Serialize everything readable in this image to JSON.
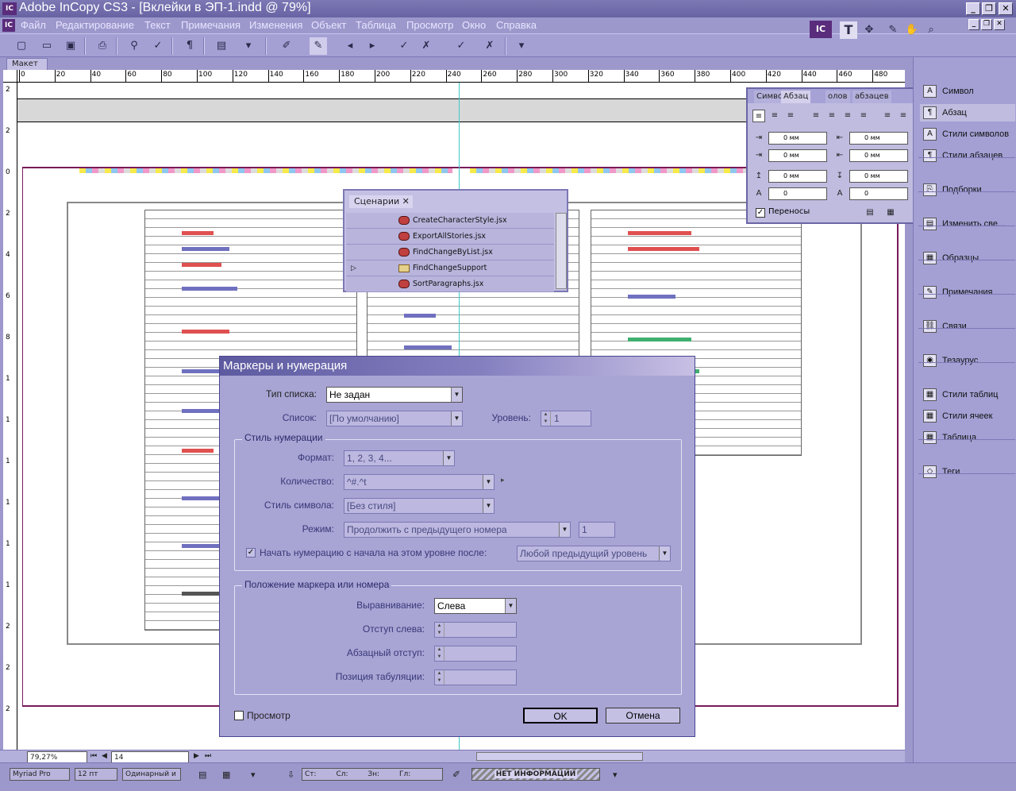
{
  "window": {
    "title": "Adobe InCopy CS3 - [Вклейки в ЭП-1.indd @ 79%]",
    "app_icon": "IC"
  },
  "menu": [
    "Файл",
    "Редактирование",
    "Текст",
    "Примечания",
    "Изменения",
    "Объект",
    "Таблица",
    "Просмотр",
    "Окно",
    "Справка"
  ],
  "toolbar": {
    "right_icon": "IC"
  },
  "doc_tab": "Макет",
  "ruler": {
    "h_ticks": [
      "0",
      "20",
      "40",
      "60",
      "80",
      "100",
      "120",
      "140",
      "160",
      "180",
      "200",
      "220",
      "240",
      "260",
      "280",
      "300",
      "320",
      "340",
      "360",
      "380",
      "400",
      "420",
      "440",
      "460",
      "480"
    ],
    "v_ticks": [
      "2",
      "2",
      "0",
      "2",
      "4",
      "6",
      "8",
      "1",
      "1",
      "1",
      "1",
      "1",
      "1",
      "2",
      "2",
      "2"
    ]
  },
  "scripts_panel": {
    "tab": "Сценарии",
    "items": [
      "CreateCharacterStyle.jsx",
      "ExportAllStories.jsx",
      "FindChangeByList.jsx",
      "FindChangeSupport",
      "SortParagraphs.jsx"
    ]
  },
  "para_panel": {
    "tabs": [
      "Симво",
      "Абзац",
      "олов",
      "абзацев"
    ],
    "fields": [
      "0 мм",
      "0 мм",
      "0 мм",
      "0 мм",
      "0 мм",
      "0 мм",
      "0",
      "0"
    ],
    "hyphenation": "Переносы"
  },
  "right_panel": {
    "items": [
      "Символ",
      "Абзац",
      "Стили символов",
      "Стили абзацев",
      "Подборки",
      "Изменить све...",
      "Образцы",
      "Примечания",
      "Связи",
      "Тезаурус",
      "Стили таблиц",
      "Стили ячеек",
      "Таблица",
      "Теги"
    ],
    "icons": [
      "A",
      "¶",
      "A",
      "¶",
      "⎘",
      "▤",
      "▦",
      "✎",
      "⛓",
      "◉",
      "▦",
      "▦",
      "▦",
      "◇"
    ]
  },
  "dialog": {
    "title": "Маркеры и нумерация",
    "list_type_label": "Тип списка:",
    "list_type_value": "Не задан",
    "list_label": "Список:",
    "list_value": "[По умолчанию]",
    "level_label": "Уровень:",
    "level_value": "1",
    "numbering_group": "Стиль нумерации",
    "format_label": "Формат:",
    "format_value": "1, 2, 3, 4...",
    "count_label": "Количество:",
    "count_value": "^#.^t",
    "char_style_label": "Стиль символа:",
    "char_style_value": "[Без стиля]",
    "mode_label": "Режим:",
    "mode_value": "Продолжить с предыдущего номера",
    "mode_number": "1",
    "restart_label": "Начать нумерацию с начала на этом уровне после:",
    "restart_value": "Любой предыдущий уровень",
    "position_group": "Положение маркера или номера",
    "align_label": "Выравнивание:",
    "align_value": "Слева",
    "left_indent_label": "Отступ слева:",
    "first_indent_label": "Абзацный отступ:",
    "tab_pos_label": "Позиция табуляции:",
    "preview_label": "Просмотр",
    "ok": "OK",
    "cancel": "Отмена"
  },
  "bottom": {
    "zoom": "79,27%",
    "page": "14"
  },
  "status": {
    "font": "Myriad Pro",
    "size": "12 пт",
    "spacing": "Одинарный и",
    "st": "Ст:",
    "sl": "Сл:",
    "zn": "Зн:",
    "gl": "Гл:",
    "info": "НЕТ ИНФОРМАЦИИ"
  },
  "colors": {
    "chrome": "#9c98cc",
    "dialog": "#a8a4d4",
    "guide": "#40c8c8",
    "frame": "#7a1a5a"
  }
}
